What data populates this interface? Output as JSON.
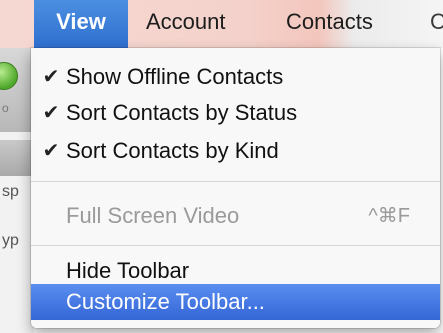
{
  "menubar": {
    "items": [
      {
        "label": "View",
        "active": true
      },
      {
        "label": "Account"
      },
      {
        "label": "Contacts"
      },
      {
        "label": "C"
      }
    ]
  },
  "background_window": {
    "fragments": [
      "o",
      "sp",
      "yp"
    ]
  },
  "view_menu": {
    "items": [
      {
        "label": "Show Offline Contacts",
        "checked": true,
        "check_mark": "✔"
      },
      {
        "label": "Sort Contacts by Status",
        "checked": true,
        "check_mark": "✔"
      },
      {
        "label": "Sort Contacts by Kind",
        "checked": true,
        "check_mark": "✔"
      },
      {
        "label": "Full Screen Video",
        "enabled": false,
        "shortcut": "^⌘F"
      },
      {
        "label": "Hide Toolbar"
      },
      {
        "label": "Customize Toolbar...",
        "highlighted": true
      }
    ]
  },
  "colors": {
    "selection_blue": "#3d72dc",
    "disabled_text": "#9a9a9a"
  }
}
